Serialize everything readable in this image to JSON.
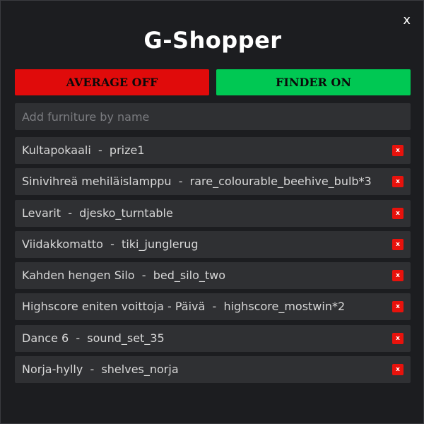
{
  "window": {
    "title": "G-Shopper",
    "close_label": "x"
  },
  "toggles": {
    "average": {
      "label": "AVERAGE OFF",
      "color": "#e00b0b",
      "state": "off"
    },
    "finder": {
      "label": "FINDER ON",
      "color": "#00c853",
      "state": "on"
    }
  },
  "search": {
    "placeholder": "Add furniture by name",
    "value": ""
  },
  "items": [
    {
      "name": "Kultapokaali",
      "code": "prize1"
    },
    {
      "name": "Sinivihreä mehiläislamppu",
      "code": "rare_colourable_beehive_bulb*3"
    },
    {
      "name": "Levarit",
      "code": "djesko_turntable"
    },
    {
      "name": "Viidakkomatto",
      "code": "tiki_junglerug"
    },
    {
      "name": "Kahden hengen Silo",
      "code": "bed_silo_two"
    },
    {
      "name": "Highscore eniten voittoja - Päivä",
      "code": "highscore_mostwin*2"
    },
    {
      "name": "Dance 6",
      "code": "sound_set_35"
    },
    {
      "name": "Norja-hylly",
      "code": "shelves_norja"
    }
  ],
  "remove_label": "x",
  "separator": "  -  ",
  "colors": {
    "background": "#1c1d20",
    "panel": "#2f3033",
    "remove": "#e8120c"
  },
  "icons": {
    "close": "close-icon",
    "remove": "remove-icon"
  }
}
